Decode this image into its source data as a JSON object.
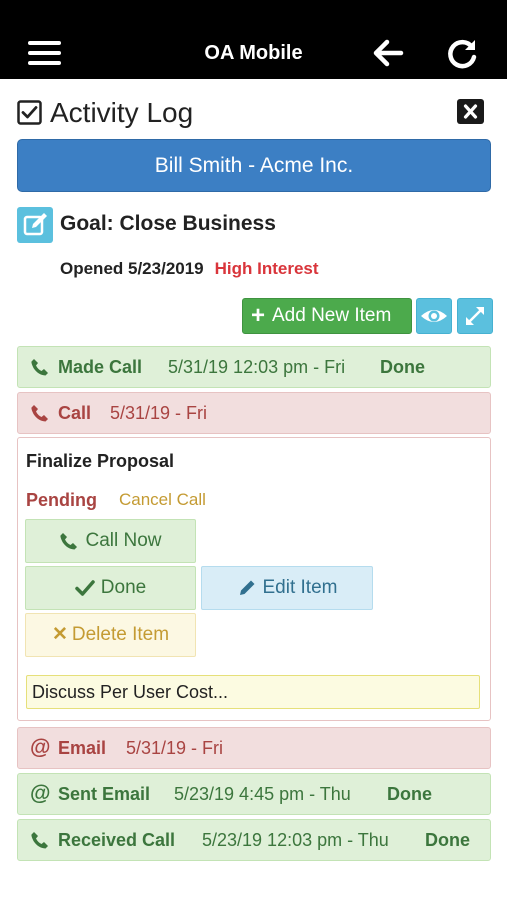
{
  "app": {
    "title": "OA Mobile"
  },
  "page": {
    "title": "Activity Log"
  },
  "contact": {
    "label": "Bill Smith - Acme Inc."
  },
  "goal": {
    "title": "Goal: Close Business",
    "opened": "Opened 5/23/2019",
    "interest": "High Interest"
  },
  "toolbar": {
    "add_label": "Add New Item",
    "add_prefix": "+"
  },
  "activities": [
    {
      "type": "Made Call",
      "date": "5/31/19 12:03 pm - Fri",
      "status": "Done",
      "icon": "phone-icon",
      "color": "green"
    },
    {
      "type": "Call",
      "date": "5/31/19 - Fri",
      "status": "",
      "icon": "phone-icon",
      "color": "red"
    },
    {
      "type": "Email",
      "date": "5/31/19 - Fri",
      "status": "",
      "icon": "at-icon",
      "color": "red"
    },
    {
      "type": "Sent Email",
      "date": "5/23/19 4:45 pm - Thu",
      "status": "Done",
      "icon": "at-icon",
      "color": "green"
    },
    {
      "type": "Received Call",
      "date": "5/23/19 12:03 pm - Thu",
      "status": "Done",
      "icon": "phone-icon",
      "color": "green"
    }
  ],
  "detail": {
    "title": "Finalize Proposal",
    "status": "Pending",
    "cancel_label": "Cancel Call",
    "call_now_label": "Call Now",
    "done_label": "Done",
    "edit_label": "Edit Item",
    "delete_label": "Delete Item",
    "delete_glyph": "✕",
    "note_value": "Discuss Per User Cost..."
  },
  "colors": {
    "green_text": "#3c763d",
    "red_text": "#a94442",
    "accent_blue": "#3c7fc4",
    "interest_red": "#d9353b"
  }
}
